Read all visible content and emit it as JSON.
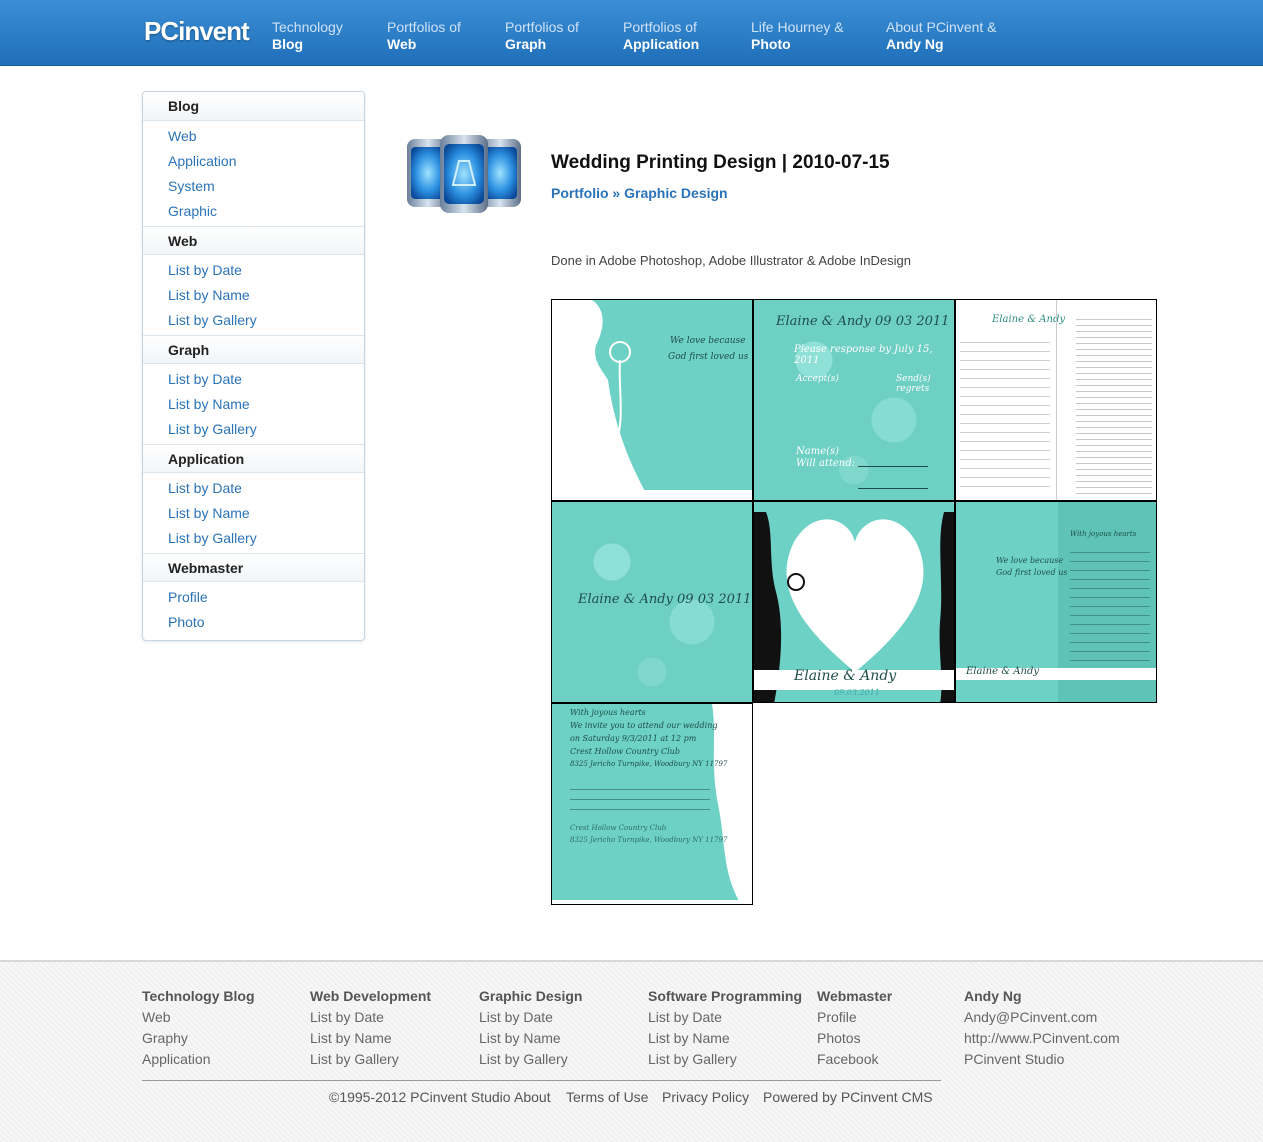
{
  "header": {
    "logo": "PCinvent",
    "nav": [
      {
        "line1": "Technology",
        "line2": "Blog"
      },
      {
        "line1": "Portfolios of",
        "line2": "Web"
      },
      {
        "line1": "Portfolios of",
        "line2": "Graph"
      },
      {
        "line1": "Portfolios of",
        "line2": "Application"
      },
      {
        "line1": "Life Hourney &",
        "line2": "Photo"
      },
      {
        "line1": "About PCinvent &",
        "line2": "Andy Ng"
      }
    ]
  },
  "sidebar": {
    "sections": [
      {
        "title": "Blog",
        "links": [
          "Web",
          "Application",
          "System",
          "Graphic"
        ]
      },
      {
        "title": "Web",
        "links": [
          "List by Date",
          "List by Name",
          "List by Gallery"
        ]
      },
      {
        "title": "Graph",
        "links": [
          "List by Date",
          "List by Name",
          "List by Gallery"
        ]
      },
      {
        "title": "Application",
        "links": [
          "List by Date",
          "List by Name",
          "List by Gallery"
        ]
      },
      {
        "title": "Webmaster",
        "links": [
          "Profile",
          "Photo"
        ]
      }
    ]
  },
  "post": {
    "title": "Wedding Printing Design | 2010-07-15",
    "breadcrumb_1": "Portfolio",
    "breadcrumb_sep": " » ",
    "breadcrumb_2": "Graphic Design",
    "body": "Done in Adobe Photoshop, Adobe Illustrator & Adobe InDesign"
  },
  "gallery": {
    "t1_text1": "We love because",
    "t1_text2": "God first loved us",
    "t2_names": "Elaine & Andy 09 03 2011",
    "t2_rsvp": "Please response by July 15, 2011",
    "t2_accept": "Accept(s)",
    "t2_send": "Send(s) regrets",
    "t2_name": "Name(s)",
    "t2_attend": "Will attend:",
    "t3_names": "Elaine & Andy",
    "t4_names": "Elaine & Andy 09 03 2011",
    "t5_names": "Elaine & Andy",
    "t5_date": "09.03.2011",
    "t6_text1": "We love because",
    "t6_text2": "God first loved us",
    "t6_right1": "With joyous hearts",
    "t6_bottom": "Elaine & Andy",
    "t7_l1": "With joyous hearts",
    "t7_l2": "We invite you to attend our wedding",
    "t7_l3": "on Saturday 9/3/2011 at 12 pm",
    "t7_l4": "Crest Hollow Country Club",
    "t7_l5": "8325 Jericho Turnpike, Woodbury NY 11797",
    "t7_l6": "Crest Hollow Country Club",
    "t7_l7": "8325 Jericho Turnpike, Woodbury NY 11797"
  },
  "footer": {
    "columns": [
      {
        "head": "Technology Blog",
        "links": [
          "Web",
          "Graphy",
          "Application"
        ]
      },
      {
        "head": "Web Development",
        "links": [
          "List by Date",
          "List by Name",
          "List by Gallery"
        ]
      },
      {
        "head": "Graphic Design",
        "links": [
          "List by Date",
          "List by Name",
          "List by Gallery"
        ]
      },
      {
        "head": "Software Programming",
        "links": [
          "List by Date",
          "List by Name",
          "List by Gallery"
        ]
      },
      {
        "head": "Webmaster",
        "links": [
          "Profile",
          "Photos",
          "Facebook"
        ]
      },
      {
        "head": "Andy Ng",
        "links": [
          "Andy@PCinvent.com",
          "http://www.PCinvent.com",
          "PCinvent Studio"
        ]
      }
    ],
    "copyright": "©1995-2012 PCinvent Studio",
    "about": "About",
    "terms": "Terms of Use",
    "privacy": "Privacy Policy",
    "powered": "Powered by PCinvent CMS"
  },
  "colors": {
    "header": "#1f6fb9",
    "link": "#2a73b8",
    "teal": "#6dd1c5"
  }
}
